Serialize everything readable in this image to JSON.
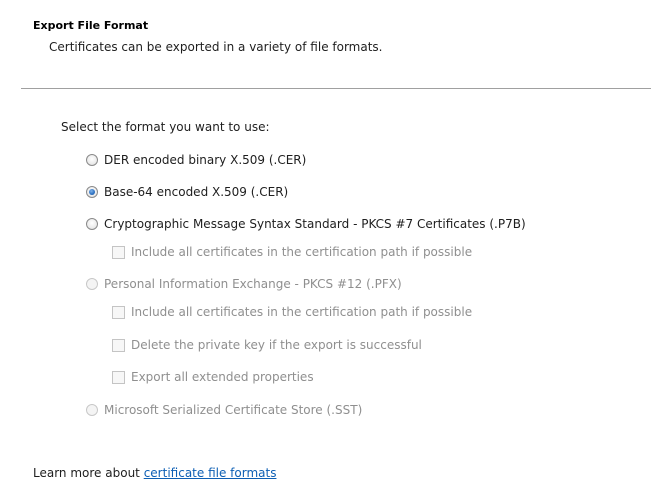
{
  "header": {
    "title": "Export File Format",
    "subtitle": "Certificates can be exported in a variety of file formats."
  },
  "prompt": "Select the format you want to use:",
  "options": {
    "der": {
      "label": "DER encoded binary X.509 (.CER)",
      "checked": false,
      "enabled": true
    },
    "base64": {
      "label": "Base-64 encoded X.509 (.CER)",
      "checked": true,
      "enabled": true
    },
    "pkcs7": {
      "label": "Cryptographic Message Syntax Standard - PKCS #7 Certificates (.P7B)",
      "checked": false,
      "enabled": true
    },
    "pkcs7_include_all": {
      "label": "Include all certificates in the certification path if possible",
      "checked": false,
      "enabled": false
    },
    "pfx": {
      "label": "Personal Information Exchange - PKCS #12 (.PFX)",
      "checked": false,
      "enabled": false
    },
    "pfx_include_all": {
      "label": "Include all certificates in the certification path if possible",
      "checked": false,
      "enabled": false
    },
    "pfx_delete_key": {
      "label": "Delete the private key if the export is successful",
      "checked": false,
      "enabled": false
    },
    "pfx_export_props": {
      "label": "Export all extended properties",
      "checked": false,
      "enabled": false
    },
    "sst": {
      "label": "Microsoft Serialized Certificate Store (.SST)",
      "checked": false,
      "enabled": false
    }
  },
  "footer": {
    "learn_prefix": "Learn more about ",
    "learn_link": "certificate file formats"
  },
  "colors": {
    "link": "#0d5fb4",
    "disabled_text": "#8f8f8f",
    "radio_selected": "#2a6fc0"
  }
}
